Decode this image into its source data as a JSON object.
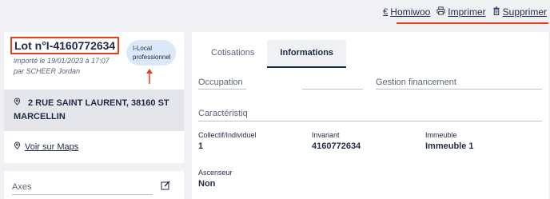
{
  "actions": {
    "homiwoo": {
      "icon": "euro-icon",
      "glyph": "€",
      "label": "Homiwoo"
    },
    "print": {
      "icon": "printer-icon",
      "glyph": "⎙",
      "label": "Imprimer"
    },
    "delete": {
      "icon": "trash-icon",
      "glyph": "🗑",
      "label": "Supprimer"
    },
    "accent_color": "#e8401c"
  },
  "lot": {
    "title": "Lot n°I-4160772634",
    "imported": "importé le 19/01/2023 à 17:07",
    "by": "par SCHEER Jordan",
    "badge_line1": "I-Local",
    "badge_line2": "professionnel",
    "address": "2 RUE SAINT LAURENT, 38160 ST MARCELLIN",
    "maps_label": "Voir sur Maps"
  },
  "axes": {
    "label": "Axes"
  },
  "tabs": [
    {
      "label": "Cotisations",
      "active": false
    },
    {
      "label": "Informations",
      "active": true
    }
  ],
  "form": {
    "occupation_label": "Occupation",
    "financement_label": "Gestion financement",
    "caracteristiq_label": "Caractéristiq"
  },
  "details": {
    "collectif_label": "Collectif/Individuel",
    "collectif_value": "1",
    "invariant_label": "Invariant",
    "invariant_value": "4160772634",
    "immeuble_label": "Immeuble",
    "immeuble_value": "Immeuble 1",
    "ascenseur_label": "Ascenseur",
    "ascenseur_value": "Non"
  }
}
